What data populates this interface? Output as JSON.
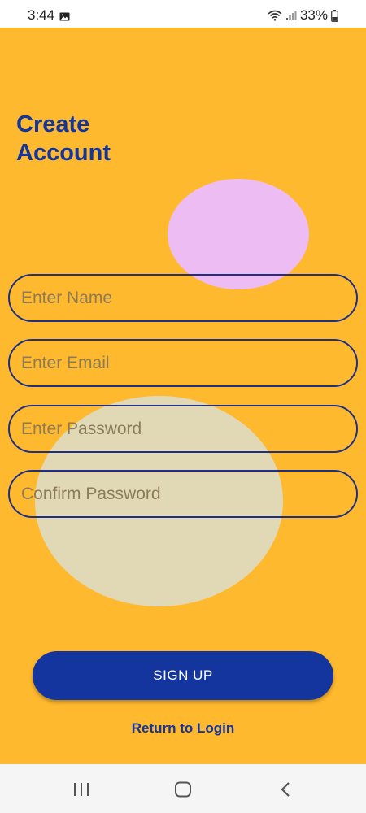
{
  "status_bar": {
    "time": "3:44",
    "battery": "33%",
    "icons": [
      "image-icon",
      "wifi-icon",
      "signal-icon",
      "battery-icon"
    ]
  },
  "screen": {
    "title_line1": "Create",
    "title_line2": "Account",
    "background_color": "#FFB92E",
    "accent_color": "#14349E"
  },
  "form": {
    "name_placeholder": "Enter Name",
    "email_placeholder": "Enter Email",
    "password_placeholder": "Enter Password",
    "confirm_placeholder": "Confirm Password"
  },
  "actions": {
    "signup_label": "SIGN UP",
    "return_label": "Return to Login"
  },
  "nav_bar": {
    "icons": [
      "recents-icon",
      "home-icon",
      "back-icon"
    ]
  }
}
